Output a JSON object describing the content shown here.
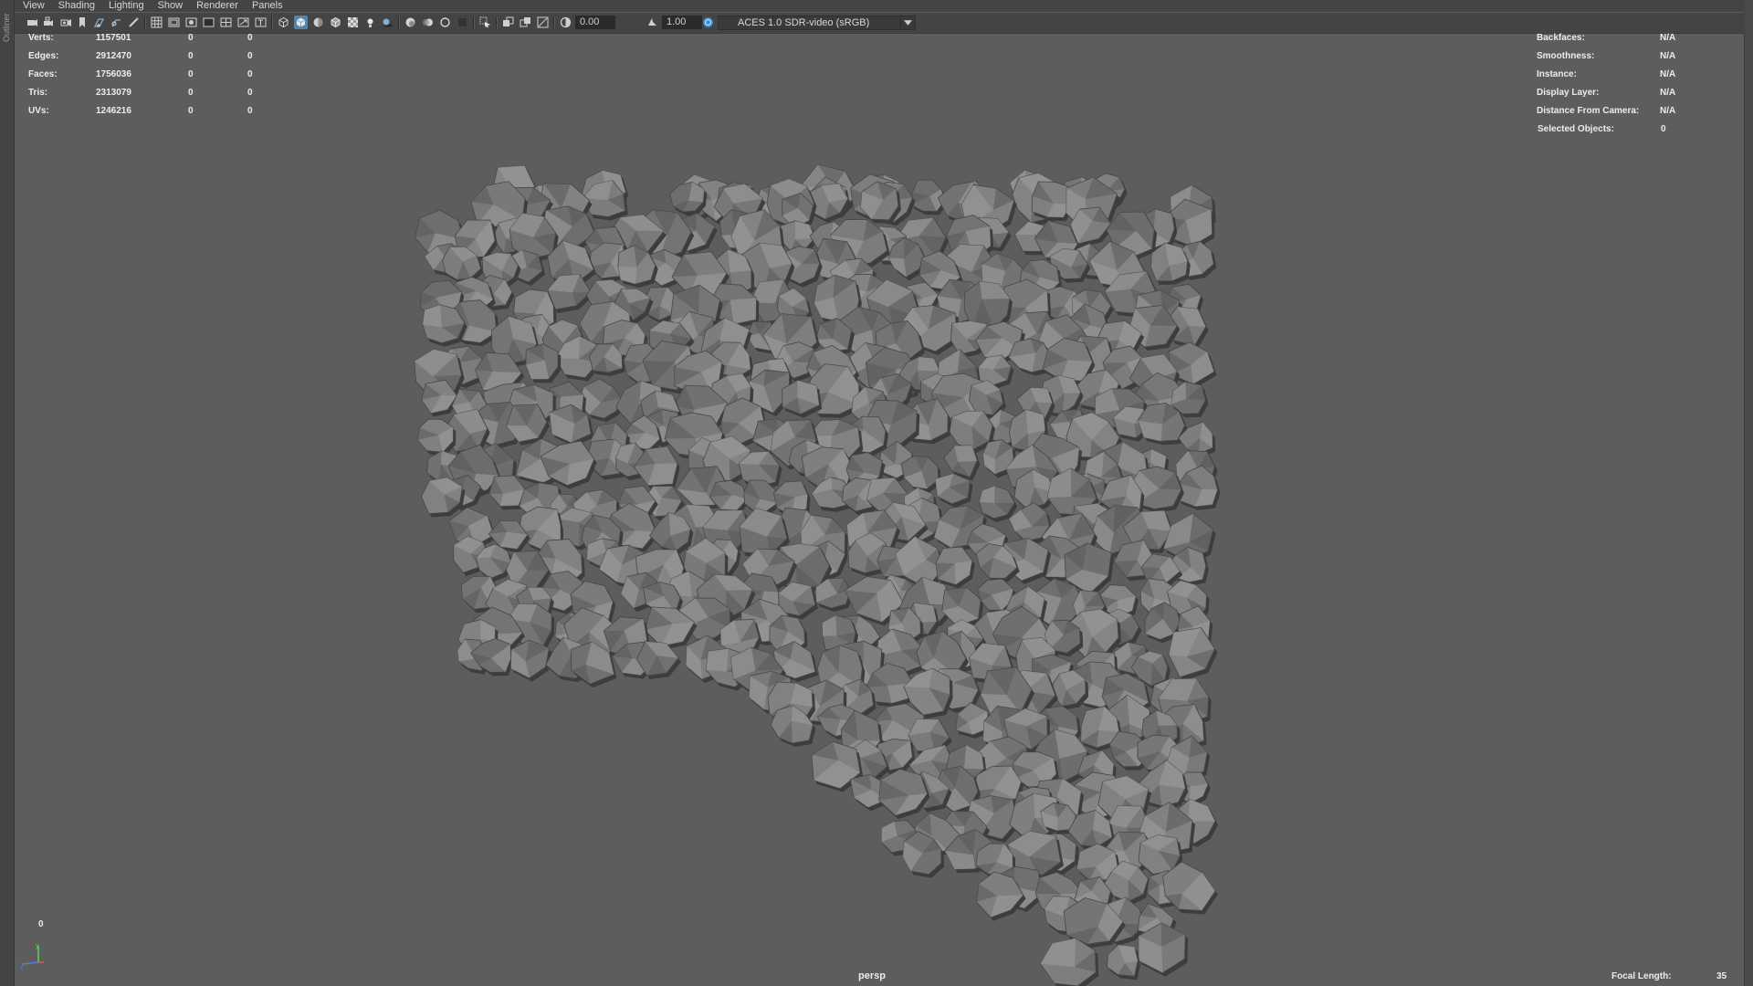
{
  "outliner_tab": "Outliner",
  "menu": [
    "View",
    "Shading",
    "Lighting",
    "Show",
    "Renderer",
    "Panels"
  ],
  "toolbar": {
    "exposure": "0.00",
    "gamma": "1.00",
    "color_management": "ACES 1.0 SDR-video (sRGB)"
  },
  "hud_left": [
    {
      "label": "Verts:",
      "v1": "1157501",
      "v2": "0",
      "v3": "0"
    },
    {
      "label": "Edges:",
      "v1": "2912470",
      "v2": "0",
      "v3": "0"
    },
    {
      "label": "Faces:",
      "v1": "1756036",
      "v2": "0",
      "v3": "0"
    },
    {
      "label": "Tris:",
      "v1": "2313079",
      "v2": "0",
      "v3": "0"
    },
    {
      "label": "UVs:",
      "v1": "1246216",
      "v2": "0",
      "v3": "0"
    }
  ],
  "hud_right": [
    {
      "label": "Backfaces:",
      "value": "N/A"
    },
    {
      "label": "Smoothness:",
      "value": "N/A"
    },
    {
      "label": "Instance:",
      "value": "N/A"
    },
    {
      "label": "Display Layer:",
      "value": "N/A"
    },
    {
      "label": "Distance From Camera:",
      "value": "N/A"
    },
    {
      "label": "Selected Objects:",
      "value": "0"
    }
  ],
  "viewport": {
    "camera": "persp",
    "focal_label": "Focal Length:",
    "focal_value": "35",
    "axis_zero": "0"
  },
  "colors": {
    "viewport_bg": "#5d5d5d",
    "rock_fill": "#7c7c7c",
    "toolbar_bg": "#444444",
    "active_blue": "#5285a6"
  },
  "icons": [
    "camera-select-icon",
    "camera-lock-icon",
    "camera-attributes-icon",
    "bookmark-icon",
    "image-plane-icon",
    "2d-pan-zoom-icon",
    "grease-pencil-icon",
    "grid-icon",
    "film-gate-icon",
    "resolution-gate-icon",
    "gate-mask-icon",
    "field-chart-icon",
    "safe-action-icon",
    "safe-title-icon",
    "wireframe-icon",
    "smooth-shade-all-icon",
    "default-material-icon",
    "wireframe-on-shaded-icon",
    "textured-icon",
    "use-all-lights-icon",
    "shadows-icon",
    "screen-space-ao-icon",
    "motion-blur-icon",
    "anti-aliasing-icon",
    "depth-of-field-icon",
    "isolate-select-icon",
    "xray-icon",
    "xray-joints-icon",
    "xray-components-icon",
    "exposure-icon",
    "gamma-icon",
    "color-management-icon"
  ]
}
